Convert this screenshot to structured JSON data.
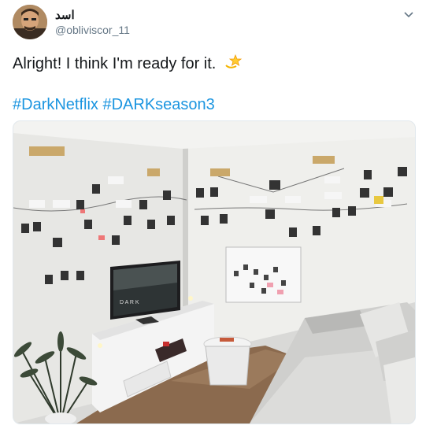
{
  "author": {
    "name": "اسد",
    "handle": "@obliviscor_11"
  },
  "tweet": {
    "text": "Alright! I think I'm ready for it.",
    "emoji": "dizzy-star-icon",
    "hashtags": [
      "#DarkNetflix",
      "#DARKseason3"
    ]
  },
  "media": {
    "tv_text": "D A R K",
    "description_icon": "photo"
  },
  "colors": {
    "link": "#1b95e0",
    "handle": "#657786",
    "wall": "#e8e8e6"
  }
}
